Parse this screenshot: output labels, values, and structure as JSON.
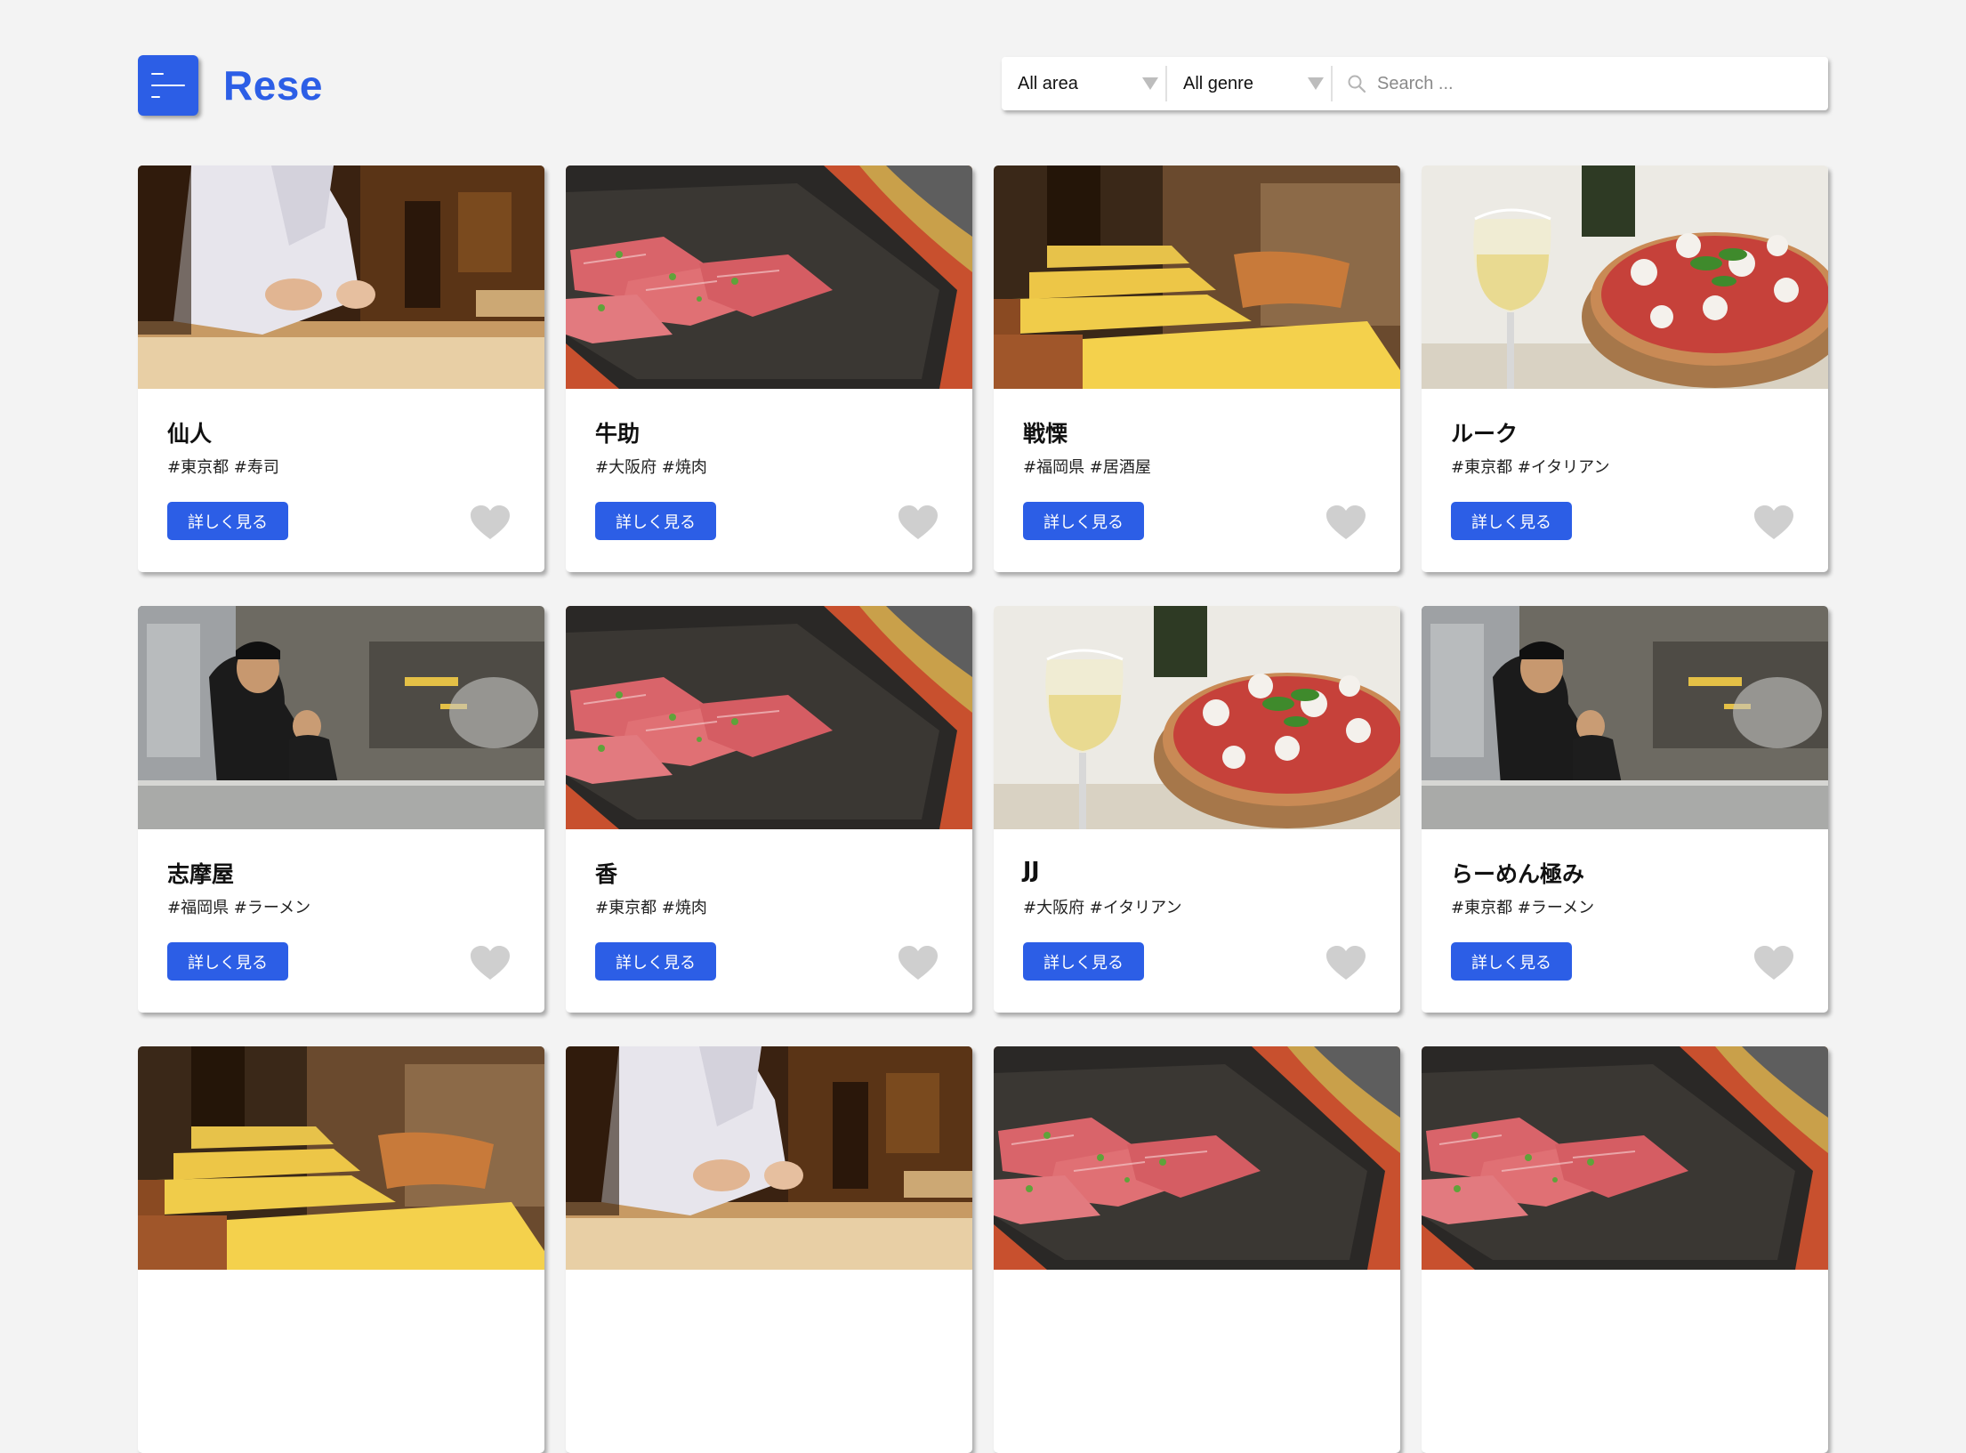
{
  "header": {
    "logo": "Rese",
    "area_select": "All area",
    "genre_select": "All genre",
    "search_placeholder": "Search ..."
  },
  "colors": {
    "accent": "#2c5ee6",
    "background": "#f3f3f3",
    "heart": "#cfcfcf"
  },
  "cards": [
    {
      "name": "仙人",
      "tags": "#東京都 #寿司",
      "button": "詳しく見る",
      "photo": "sushi-chef"
    },
    {
      "name": "牛助",
      "tags": "#大阪府 #焼肉",
      "button": "詳しく見る",
      "photo": "yakiniku-meat"
    },
    {
      "name": "戦慄",
      "tags": "#福岡県 #居酒屋",
      "button": "詳しく見る",
      "photo": "izakaya-tables"
    },
    {
      "name": "ルーク",
      "tags": "#東京都 #イタリアン",
      "button": "詳しく見る",
      "photo": "pizza-wine"
    },
    {
      "name": "志摩屋",
      "tags": "#福岡県 #ラーメン",
      "button": "詳しく見る",
      "photo": "ramen-kitchen"
    },
    {
      "name": "香",
      "tags": "#東京都 #焼肉",
      "button": "詳しく見る",
      "photo": "yakiniku-meat"
    },
    {
      "name": "JJ",
      "tags": "#大阪府 #イタリアン",
      "button": "詳しく見る",
      "photo": "pizza-wine"
    },
    {
      "name": "らーめん極み",
      "tags": "#東京都 #ラーメン",
      "button": "詳しく見る",
      "photo": "ramen-kitchen"
    },
    {
      "name": "",
      "tags": "",
      "button": "",
      "photo": "izakaya-tables"
    },
    {
      "name": "",
      "tags": "",
      "button": "",
      "photo": "sushi-chef"
    },
    {
      "name": "",
      "tags": "",
      "button": "",
      "photo": "yakiniku-meat"
    },
    {
      "name": "",
      "tags": "",
      "button": "",
      "photo": "yakiniku-meat"
    }
  ]
}
